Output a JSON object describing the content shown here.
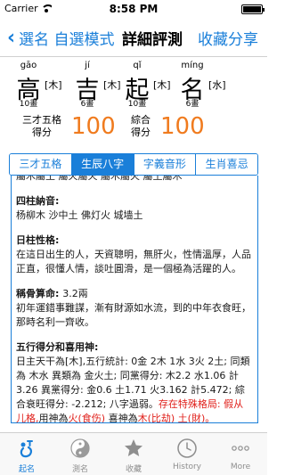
{
  "status": {
    "carrier": "Carrier",
    "time": "8:58 PM"
  },
  "nav": {
    "back_label": "選名 自選模式",
    "title": "詳細評測",
    "share_label": "收藏分享"
  },
  "name_chars": [
    {
      "pinyin": "gāo",
      "char": "高",
      "element": "[木]",
      "strokes": "10畫"
    },
    {
      "pinyin": "jí",
      "char": "吉",
      "element": "[木]",
      "strokes": "6畫"
    },
    {
      "pinyin": "qǐ",
      "char": "起",
      "element": "[木]",
      "strokes": "10畫"
    },
    {
      "pinyin": "míng",
      "char": "名",
      "element": "[水]",
      "strokes": "6畫"
    }
  ],
  "scores": {
    "sancai_label_1": "三才五格",
    "sancai_label_2": "得分",
    "sancai_value": "100",
    "overall_label_1": "綜合",
    "overall_label_2": "得分",
    "overall_value": "100"
  },
  "tabs": [
    {
      "label": "三才五格"
    },
    {
      "label": "生辰八字"
    },
    {
      "label": "字義音形"
    },
    {
      "label": "生肖喜忌"
    }
  ],
  "content": {
    "top_line": "屬木屬土 屬火屬火 屬木屬火 屬土屬木",
    "nayin_title": "四柱納音:",
    "nayin_text": "杨柳木 沙中土 佛灯火 城墙土",
    "rizhu_title": "日柱性格:",
    "rizhu_text": "在這日出生的人，天資聰明，無肝火，性情溫厚，人品正直，很懂人情，談吐圓滑，是一個極為活躍的人。",
    "chenggu_title": "稱骨算命:",
    "chenggu_value": "3.2兩",
    "chenggu_text": "初年運錯事難謀，漸有財源如水流，到的中年衣食旺，那時名利一齊收。",
    "wuxing_title": "五行得分和喜用神:",
    "wuxing_text": "日主天干為[木],五行統計: 0金 2木 1水 3火 2土; 同類為 木水 異類為 金火土; 同黨得分: 木2.2 水1.06 計3.26 異黨得分: 金0.6 土1.71 火3.162 計5.472; 綜合衰旺得分: -2.212; 八字過弱。",
    "special_text": "存在特殊格局: 假从儿格,",
    "yongshen_label": "用神為",
    "yongshen_value": "火(食伤)",
    "xishen_label": "喜神為",
    "xishen_value": "木(比劫) 土(財)。"
  },
  "tab_bar": [
    {
      "label": "起名",
      "icon": "naming-icon"
    },
    {
      "label": "測名",
      "icon": "yin-yang-icon"
    },
    {
      "label": "收藏",
      "icon": "star-icon"
    },
    {
      "label": "History",
      "icon": "clock-icon"
    },
    {
      "label": "More",
      "icon": "more-icon"
    }
  ],
  "colors": {
    "accent": "#1a7fd9",
    "score": "#f07b1e",
    "highlight": "#e0201b"
  }
}
